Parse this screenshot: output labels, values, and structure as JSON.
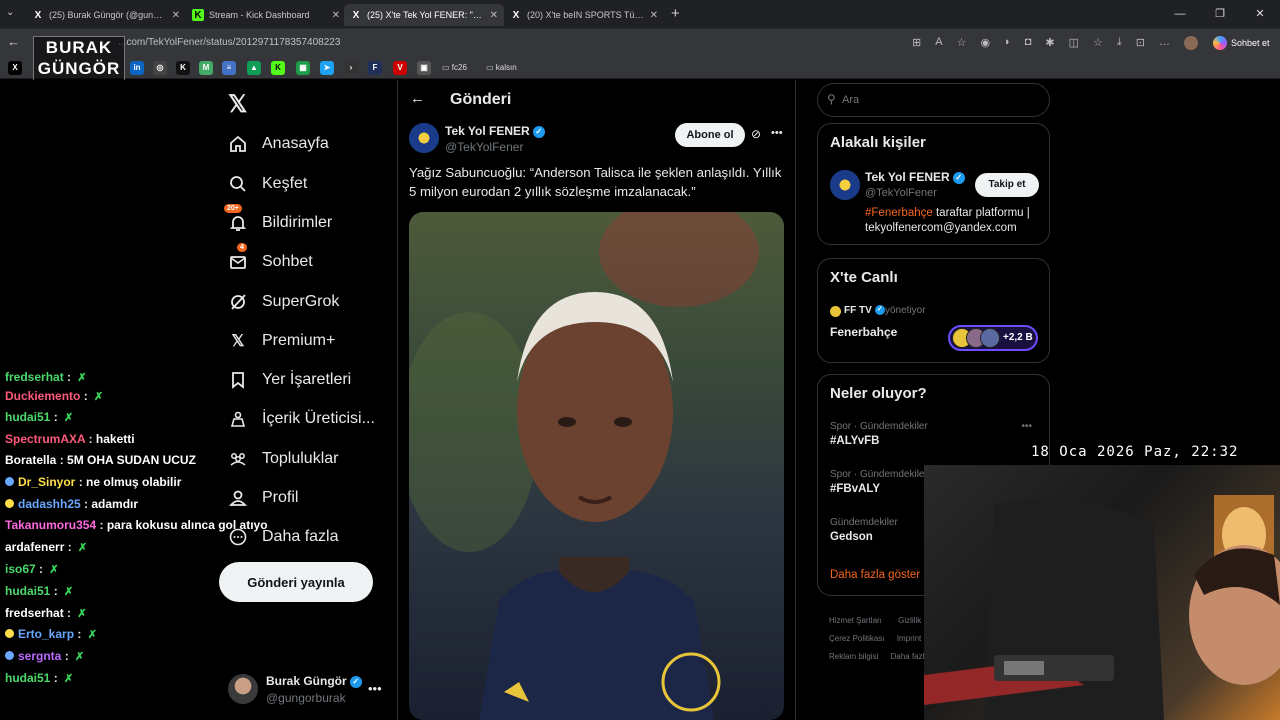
{
  "tabs": [
    {
      "icon": "X",
      "label": "(25) Burak Güngör (@gungorburak)"
    },
    {
      "icon": "K",
      "label": "Stream - Kick Dashboard"
    },
    {
      "icon": "X",
      "label": "(25) X'te Tek Yol FENER: \"Yağız Sab..."
    },
    {
      "icon": "X",
      "label": "(20) X'te beIN SPORTS Türkiye: \""
    }
  ],
  "address": {
    "url": "...com/TekYolFener/status/2012971178357408223"
  },
  "overlay": {
    "logo_line1": "BURAK",
    "logo_line2": "GÜNGÖR",
    "timestamp": "18 Oca 2026 Paz, 22:32"
  },
  "bookmarks": {
    "folder1": "fc26",
    "folder2": "kalsın"
  },
  "browser": {
    "copilot_label": "Sohbet et"
  },
  "chat": [
    {
      "user": "fredserhat",
      "color": "#4dd96a",
      "msg": ""
    },
    {
      "user": "Duckiemento",
      "color": "#ff5a7a",
      "msg": ""
    },
    {
      "user": "hudai51",
      "color": "#4dd96a",
      "msg": ""
    },
    {
      "user": "SpectrumAXA",
      "color": "#ff5a7a",
      "msg": "haketti"
    },
    {
      "user": "Boratella",
      "color": "#ffffff",
      "msg": "5M OHA SUDAN UCUZ"
    },
    {
      "user": "Dr_Sinyor",
      "color": "#ffde4a",
      "msg": "ne olmuş olabilir"
    },
    {
      "user": "dadashh25",
      "color": "#6aa8ff",
      "msg": "adamdır"
    },
    {
      "user": "Takanumoru354",
      "color": "#ff6adf",
      "msg": "para kokusu alınca gol atıyo"
    },
    {
      "user": "ardafenerr",
      "color": "#ffffff",
      "msg": ""
    },
    {
      "user": "iso67",
      "color": "#4dd96a",
      "msg": ""
    },
    {
      "user": "hudai51",
      "color": "#4dd96a",
      "msg": ""
    },
    {
      "user": "fredserhat",
      "color": "#ffffff",
      "msg": ""
    },
    {
      "user": "Erto_karp",
      "color": "#6aa8ff",
      "msg": ""
    },
    {
      "user": "sergnta",
      "color": "#b86aff",
      "msg": ""
    },
    {
      "user": "hudai51",
      "color": "#4dd96a",
      "msg": ""
    }
  ],
  "nav": {
    "home": "Anasayfa",
    "explore": "Keşfet",
    "notifications": "Bildirimler",
    "notif_badge": "20+",
    "chat": "Sohbet",
    "chat_badge": "4",
    "grok": "SuperGrok",
    "premium": "Premium+",
    "bookmarks": "Yer İşaretleri",
    "creator": "İçerik Üreticisi...",
    "communities": "Topluluklar",
    "profile": "Profil",
    "more": "Daha fazla",
    "post_button": "Gönderi yayınla"
  },
  "account": {
    "name": "Burak Güngör",
    "handle": "@gungorburak"
  },
  "post": {
    "header": "Gönderi",
    "author": "Tek Yol FENER",
    "handle": "@TekYolFener",
    "subscribe": "Abone ol",
    "text": "Yağız Sabuncuoğlu: “Anderson Talisca ile şeklen anlaşıldı. Yıllık 5 milyon eurodan 2 yıllık sözleşme imzalanacak.”"
  },
  "search": {
    "placeholder": "Ara"
  },
  "related": {
    "title": "Alakalı kişiler",
    "name": "Tek Yol FENER",
    "handle": "@TekYolFener",
    "follow": "Takip et",
    "bio_hashtag": "#Fenerbahçe",
    "bio_rest": " taraftar platformu | tekyolfenercom@yandex.com"
  },
  "live": {
    "title": "X'te Canlı",
    "host": "FF TV",
    "role": "yönetiyor",
    "name": "Fenerbahçe",
    "listeners": "+2,2 B"
  },
  "trends": {
    "title": "Neler oluyor?",
    "items": [
      {
        "meta": "Spor · Gündemdekiler",
        "name": "#ALYvFB"
      },
      {
        "meta": "Spor · Gündemdekiler",
        "name": "#FBvALY"
      },
      {
        "meta": "Gündemdekiler",
        "name": "Gedson"
      }
    ],
    "show_more": "Daha fazla göster"
  },
  "footer": {
    "l1a": "Hizmet Şartları",
    "l1b": "Gizlilik",
    "l2a": "Çerez Politikası",
    "l2b": "Imprint",
    "l3a": "Reklam bilgisi",
    "l3b": "Daha fazla"
  },
  "colors": {
    "accent": "#1d9bf0",
    "trend_link": "#f4671f"
  }
}
